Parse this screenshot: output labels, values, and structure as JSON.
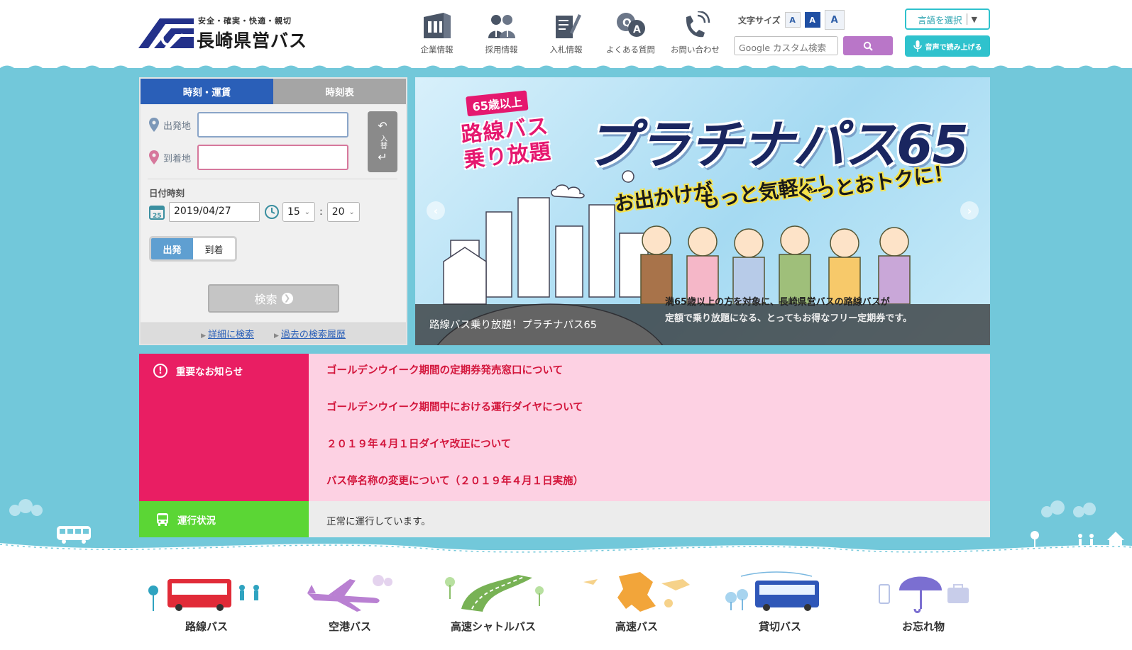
{
  "header": {
    "logo_tagline": "安全・確実・快適・親切",
    "logo_name": "長崎県営バス",
    "nav": [
      {
        "label": "企業情報",
        "icon": "building-icon"
      },
      {
        "label": "採用情報",
        "icon": "people-icon"
      },
      {
        "label": "入札情報",
        "icon": "document-pen-icon"
      },
      {
        "label": "よくある質問",
        "icon": "qa-bubble-icon"
      },
      {
        "label": "お問い合わせ",
        "icon": "phone-icon"
      }
    ],
    "font_size_label": "文字サイズ",
    "font_sizes": [
      "A",
      "A",
      "A"
    ],
    "search_placeholder": "Google カスタム検索",
    "lang_label": "言語を選択",
    "lang_arrow": "▼",
    "voice_label": "音声で読み上げる"
  },
  "route_search": {
    "tabs": [
      "時刻・運賃",
      "時刻表"
    ],
    "from_label": "出発地",
    "to_label": "到着地",
    "from_value": "",
    "to_value": "",
    "swap_label": "入替",
    "datetime_label": "日付時刻",
    "date_value": "2019/04/27",
    "hour_value": "15",
    "minute_value": "20",
    "colon": ":",
    "depart_options": [
      "出発",
      "到着"
    ],
    "submit_label": "検索",
    "links": [
      "詳細に検索",
      "過去の検索履歴"
    ]
  },
  "banner": {
    "badge_top": "65歳以上",
    "badge_line1": "路線バス",
    "badge_line2": "乗り放題",
    "title": "プラチナパス65",
    "tag1": "お出かけが",
    "tag2": "もっと気軽に！",
    "tag3": "ぐっとおトクに！",
    "caption": "路線バス乗り放題！プラチナパス65",
    "desc_line1": "満65歳以上の方を対象に、長崎県営バスの路線バスが",
    "desc_line2": "定額で乗り放題になる、とってもお得なフリー定期券です。"
  },
  "notices": {
    "title": "重要なお知らせ",
    "items": [
      "ゴールデンウイーク期間の定期券発売窓口について",
      "ゴールデンウイーク期間中における運行ダイヤについて",
      "２０１９年４月１日ダイヤ改正について",
      "バス停名称の変更について（２０１９年４月１日実施）"
    ]
  },
  "status": {
    "title": "運行状況",
    "text": "正常に運行しています。"
  },
  "services": [
    {
      "label": "路線バス",
      "icon": "route-bus-icon"
    },
    {
      "label": "空港バス",
      "icon": "airplane-icon"
    },
    {
      "label": "高速シャトルバス",
      "icon": "highway-icon"
    },
    {
      "label": "高速バス",
      "icon": "kyushu-map-icon"
    },
    {
      "label": "貸切バス",
      "icon": "charter-bus-icon"
    },
    {
      "label": "お忘れ物",
      "icon": "umbrella-icon"
    }
  ],
  "colors": {
    "sky": "#72c8da",
    "primary_blue": "#2a5fb8",
    "notice_pink": "#e91e63",
    "notice_bg": "#fdd1e3",
    "status_green": "#5bd635",
    "accent_teal": "#2fc2cd",
    "search_purple": "#b976c8"
  }
}
